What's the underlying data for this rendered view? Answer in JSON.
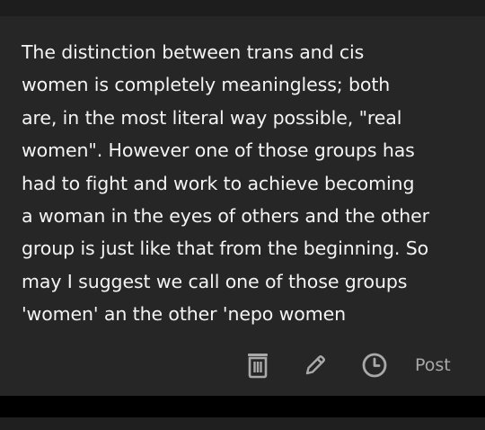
{
  "post": {
    "lines": [
      "The distinction between trans and cis",
      "women is completely meaningless; both",
      "are, in the most literal way possible, \"real",
      "women\". However one of those groups has",
      "had to fight and work to achieve becoming",
      "a woman in the eyes of others and the other",
      "group is just like that from the beginning. So",
      "may I suggest we call one of those groups",
      "'women' an the other 'nepo women"
    ]
  },
  "actions": {
    "delete_icon": "trash-icon",
    "edit_icon": "pencil-icon",
    "schedule_icon": "clock-icon",
    "post_label": "Post"
  },
  "colors": {
    "background": "#262626",
    "text": "#f4f4f4",
    "muted": "#a9a9a9"
  }
}
